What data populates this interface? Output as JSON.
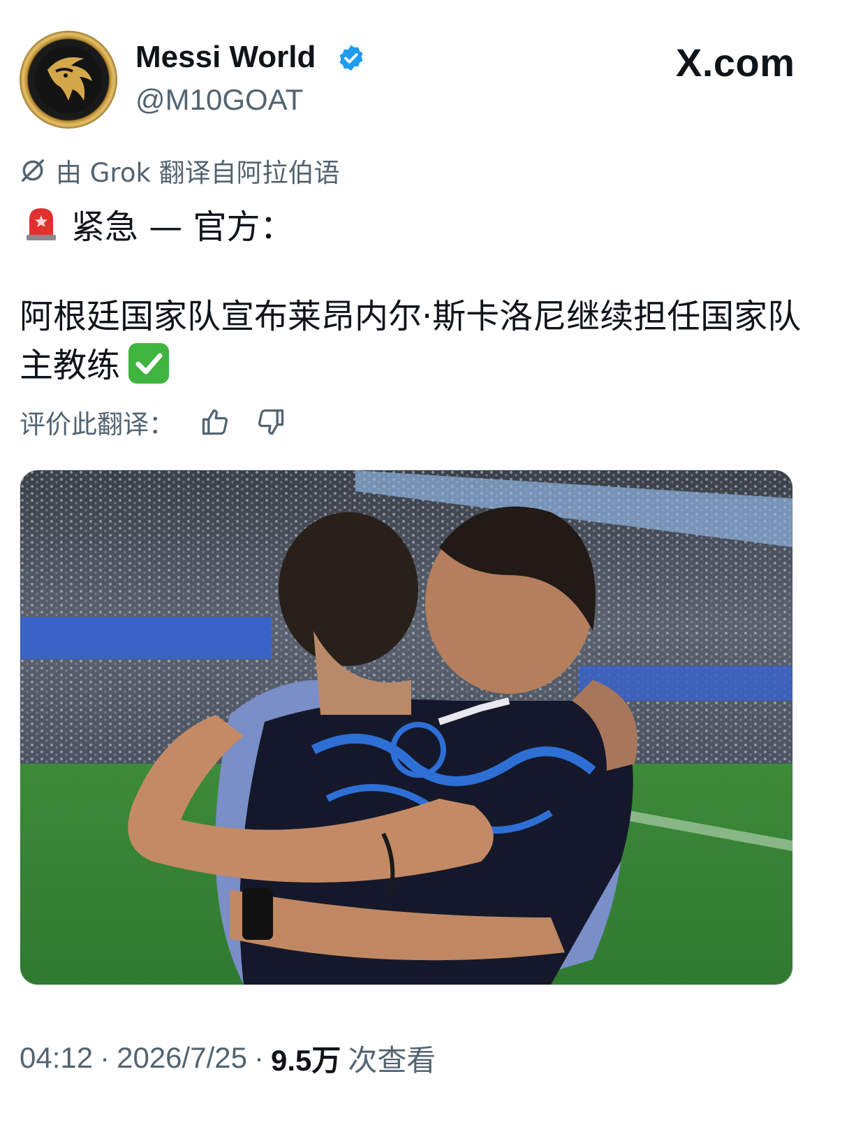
{
  "header": {
    "display_name": "Messi World",
    "handle": "@M10GOAT",
    "brand": "X.com"
  },
  "translation": {
    "note": "由 Grok 翻译自阿拉伯语",
    "rate_label": "评价此翻译："
  },
  "post": {
    "headline": "紧急 — 官方：",
    "body": "阿根廷国家队宣布莱昂内尔·斯卡洛尼继续担任国家队主教练"
  },
  "meta": {
    "time": "04:12",
    "sep1": "·",
    "date": "2026/7/25",
    "sep2": "·",
    "views": "9.5万",
    "views_label": "次查看"
  },
  "colors": {
    "verified": "#1d9bf0",
    "secondary_text": "#536471",
    "primary_text": "#0f1419"
  }
}
